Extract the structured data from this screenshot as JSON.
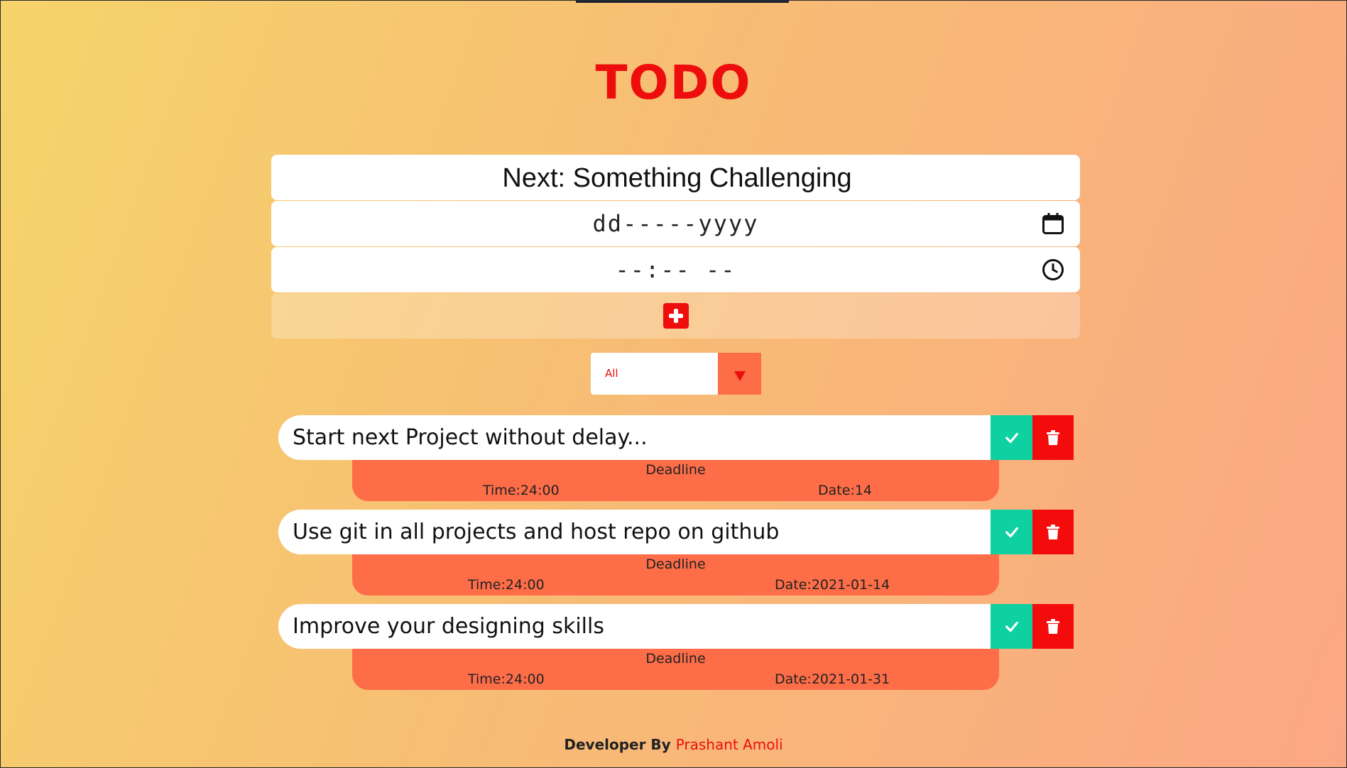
{
  "app": {
    "title": "TODO"
  },
  "form": {
    "task_value": "Next: Something Challenging",
    "date_value": "dd-----yyyy",
    "time_value": "--:-- --"
  },
  "filter": {
    "selected": "All"
  },
  "todos": [
    {
      "text": "Start next Project without delay...",
      "deadline_label": "Deadline",
      "time": "Time:24:00",
      "date": "Date:14"
    },
    {
      "text": "Use git in all projects and host repo on github",
      "deadline_label": "Deadline",
      "time": "Time:24:00",
      "date": "Date:2021-01-14"
    },
    {
      "text": "Improve your designing skills",
      "deadline_label": "Deadline",
      "time": "Time:24:00",
      "date": "Date:2021-01-31"
    }
  ],
  "footer": {
    "prefix": "Developer By",
    "author": "Prashant Amoli"
  },
  "colors": {
    "accent": "#ee0d0d",
    "complete": "#0fd0a0",
    "trash": "#f40b0b",
    "deadline": "#fd6d48"
  },
  "icons": {
    "date_picker": "calendar-icon",
    "time_picker": "clock-icon",
    "add": "plus-square-icon",
    "complete": "check-icon",
    "delete": "trash-icon",
    "filter": "triangle-down-icon"
  }
}
